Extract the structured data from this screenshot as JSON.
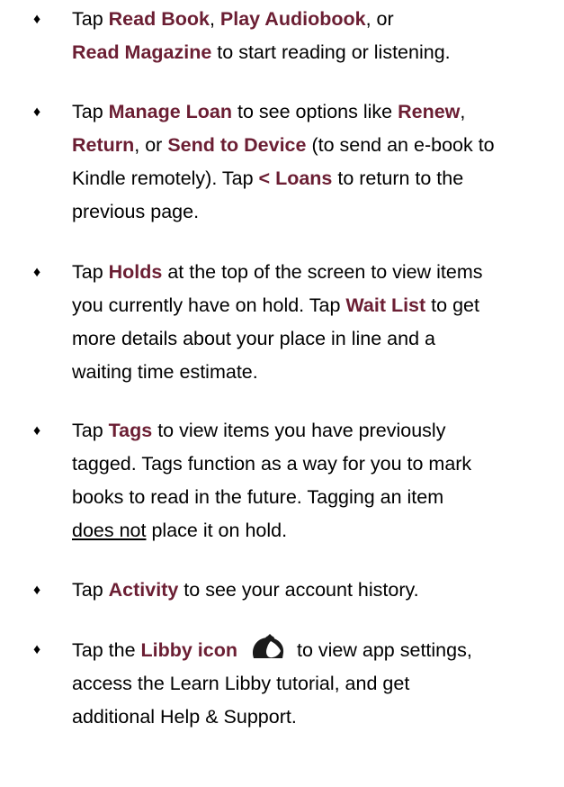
{
  "colors": {
    "accent": "#6b1e33",
    "text": "#000000"
  },
  "bullet_glyph": "♦",
  "items": [
    {
      "lines": [
        [
          "Tap ",
          "Read Book",
          ", ",
          "Play Audiobook",
          ", or"
        ],
        [
          "Read Magazine",
          " to start reading or listening."
        ]
      ]
    },
    {
      "lines": [
        [
          "Tap ",
          "Manage Loan",
          " to see options like ",
          "Renew",
          ","
        ],
        [
          "Return",
          ", or ",
          "Send to Device",
          " (to send an e-book to"
        ],
        [
          "Kindle remotely). Tap ",
          "< Loans",
          " to return to the"
        ],
        [
          "previous page."
        ]
      ]
    },
    {
      "lines": [
        [
          "Tap ",
          "Holds",
          " at the top of the screen to view items"
        ],
        [
          "you currently have on hold. Tap ",
          "Wait List",
          " to get"
        ],
        [
          "more details about your place in line and a"
        ],
        [
          "waiting time estimate."
        ]
      ]
    },
    {
      "lines": [
        [
          "Tap ",
          "Tags",
          " to view items you have previously"
        ],
        [
          "tagged. Tags function as a way for you to mark"
        ],
        [
          "books to read in the future. Tagging an item"
        ],
        [
          "does not",
          " place it on hold."
        ]
      ]
    },
    {
      "lines": [
        [
          "Tap ",
          "Activity",
          " to see your account history."
        ]
      ]
    },
    {
      "lines": [
        [
          "Tap the ",
          "Libby icon",
          "to view app settings,"
        ],
        [
          "access the Learn Libby tutorial, and get"
        ],
        [
          "additional Help & Support."
        ]
      ],
      "icon": "libby-icon"
    }
  ]
}
